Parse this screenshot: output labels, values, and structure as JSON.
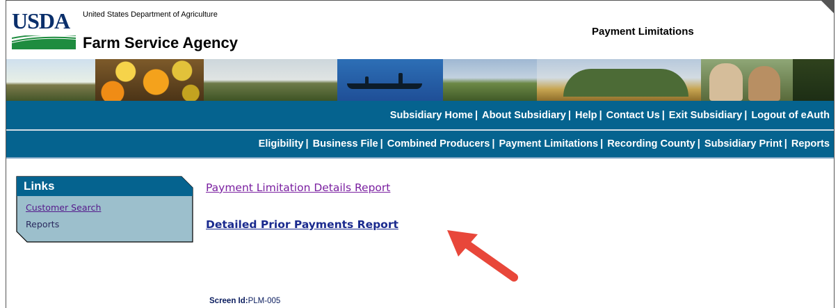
{
  "header": {
    "logo_text": "USDA",
    "department": "United States Department of Agriculture",
    "agency": "Farm Service Agency",
    "page_title": "Payment Limitations"
  },
  "nav_top": [
    {
      "label": "Subsidiary Home"
    },
    {
      "label": "About Subsidiary"
    },
    {
      "label": "Help"
    },
    {
      "label": "Contact Us"
    },
    {
      "label": "Exit Subsidiary"
    },
    {
      "label": "Logout of eAuth"
    }
  ],
  "nav_main": [
    {
      "label": "Eligibility"
    },
    {
      "label": "Business File"
    },
    {
      "label": "Combined Producers"
    },
    {
      "label": "Payment Limitations"
    },
    {
      "label": "Recording County"
    },
    {
      "label": "Subsidiary Print"
    },
    {
      "label": "Reports"
    }
  ],
  "separator": "|",
  "links": {
    "title": "Links",
    "items": [
      {
        "label": "Customer Search"
      },
      {
        "label": "Reports"
      }
    ]
  },
  "reports": {
    "item1": "Payment Limitation Details Report",
    "item2": "Detailed Prior Payments Report"
  },
  "footer": {
    "screen_id_label": "Screen Id:",
    "screen_id": "PLM-005"
  },
  "colors": {
    "nav_bg": "#05638f",
    "links_box_bg": "#9cbfcc",
    "links_header_bg": "#05638f",
    "arrow": "#e8473a"
  },
  "icons": {
    "annotation_arrow": "arrow-icon"
  }
}
